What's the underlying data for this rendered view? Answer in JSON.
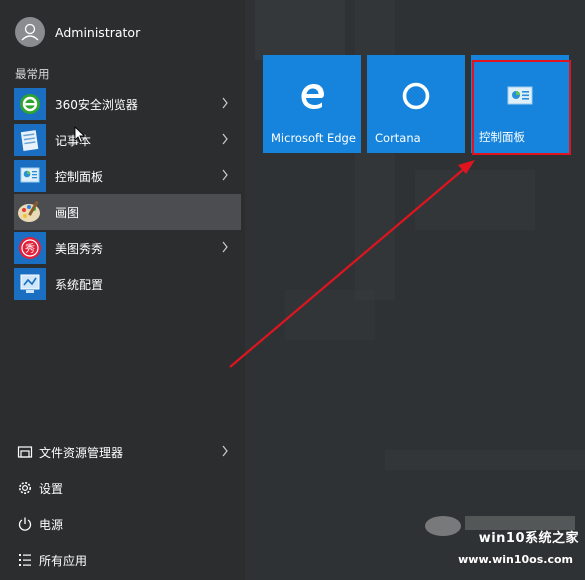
{
  "user": {
    "name": "Administrator"
  },
  "section_title": "最常用",
  "apps": [
    {
      "label": "360安全浏览器",
      "icon": "360-browser-icon",
      "has_submenu": true
    },
    {
      "label": "记事本",
      "icon": "notepad-icon",
      "has_submenu": true
    },
    {
      "label": "控制面板",
      "icon": "control-panel-icon",
      "has_submenu": true
    },
    {
      "label": "画图",
      "icon": "paint-icon",
      "has_submenu": false,
      "active": true
    },
    {
      "label": "美图秀秀",
      "icon": "meitu-icon",
      "has_submenu": true
    },
    {
      "label": "系统配置",
      "icon": "system-config-icon",
      "has_submenu": false
    }
  ],
  "bottom_items": [
    {
      "label": "文件资源管理器",
      "icon": "file-explorer-icon",
      "has_submenu": true
    },
    {
      "label": "设置",
      "icon": "settings-gear-icon"
    },
    {
      "label": "电源",
      "icon": "power-icon"
    },
    {
      "label": "所有应用",
      "icon": "all-apps-icon"
    }
  ],
  "tiles": [
    {
      "label": "Microsoft Edge",
      "icon": "edge-icon"
    },
    {
      "label": "Cortana",
      "icon": "cortana-icon"
    },
    {
      "label": "控制面板",
      "icon": "control-panel-icon",
      "highlighted": true
    }
  ],
  "watermark": {
    "text": "win10系统之家",
    "url": "www.win10os.com"
  },
  "colors": {
    "tile": "#1684dc",
    "menu_bg": "#2b2d2f",
    "highlight": "#e0141e",
    "active_item": "#4b4d50"
  }
}
